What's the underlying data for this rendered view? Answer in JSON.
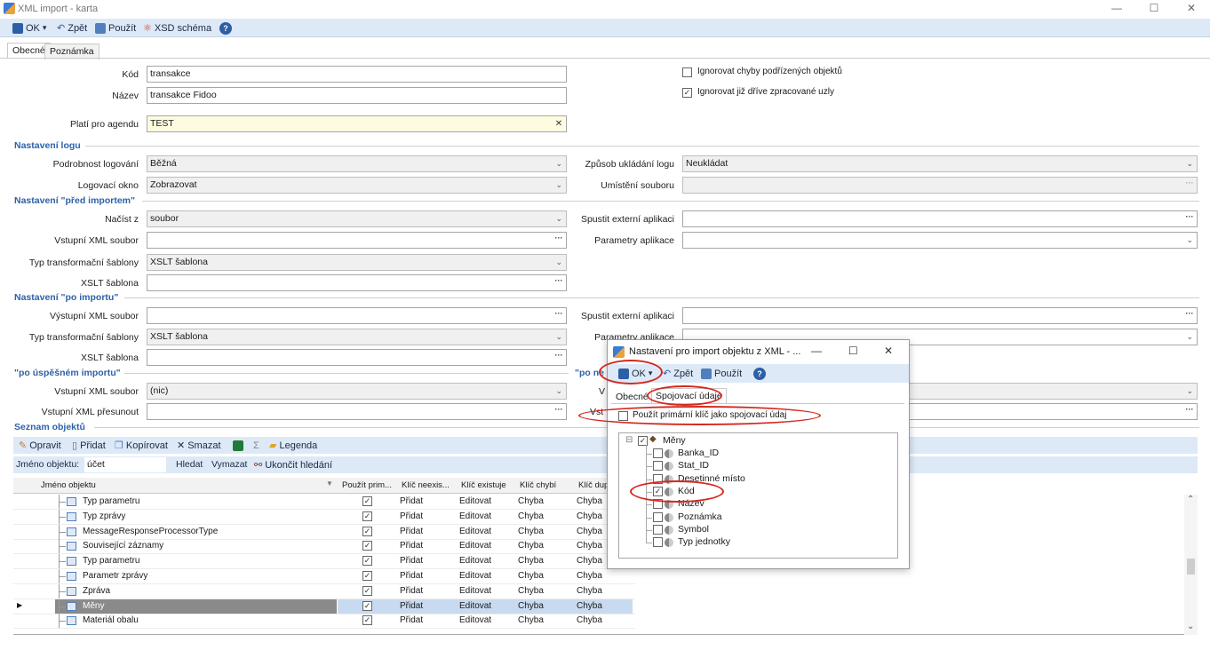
{
  "window": {
    "title": "XML import - karta",
    "min": "—",
    "max": "☐",
    "close": "✕"
  },
  "toolbar": {
    "ok": "OK",
    "dropdown": "▾",
    "back": "Zpět",
    "apply": "Použít",
    "xsd": "XSD schéma",
    "help": "?"
  },
  "tabs": [
    "Obecné",
    "Poznámka"
  ],
  "form": {
    "kod_label": "Kód",
    "kod": "transakce",
    "nazev_label": "Název",
    "nazev": "transakce Fidoo",
    "agenda_label": "Platí pro agendu",
    "agenda": "TEST",
    "clear": "✕",
    "ignore1_label": "Ignorovat chyby podřízených objektů",
    "ignore1": false,
    "ignore2_label": "Ignorovat již dříve zpracované uzly",
    "ignore2": true
  },
  "log": {
    "section": "Nastavení logu",
    "detail_label": "Podrobnost logování",
    "detail": "Běžná",
    "window_label": "Logovací okno",
    "window": "Zobrazovat",
    "save_label": "Způsob ukládání logu",
    "save": "Neukládat",
    "file_label": "Umístění souboru",
    "file": ""
  },
  "before": {
    "section": "Nastavení \"před importem\"",
    "load_label": "Načíst z",
    "load": "soubor",
    "in_label": "Vstupní XML soubor",
    "in": "",
    "type_label": "Typ transformační šablony",
    "type": "XSLT šablona",
    "xslt_label": "XSLT šablona",
    "xslt": "",
    "ext_label": "Spustit externí aplikaci",
    "ext": "",
    "params_label": "Parametry aplikace",
    "params": ""
  },
  "after": {
    "section": "Nastavení \"po importu\"",
    "out_label": "Výstupní XML soubor",
    "out": "",
    "type_label": "Typ transformační šablony",
    "type": "XSLT šablona",
    "xslt_label": "XSLT šablona",
    "xslt": "",
    "ext_label": "Spustit externí aplikaci",
    "ext": "",
    "params_label": "Parametry aplikace",
    "params": ""
  },
  "success": {
    "section": "\"po úspěšném importu\"",
    "section2": "\"po ne",
    "in_label": "Vstupní XML soubor",
    "in": "(nic)",
    "move_label": "Vstupní XML přesunout",
    "move": "",
    "clip1": "V",
    "clip2": "Vst"
  },
  "objects": {
    "section": "Seznam objektů",
    "edit": "Opravit",
    "add": "Přidat",
    "copy": "Kopírovat",
    "delete": "Smazat",
    "sigma": "Σ",
    "legend": "Legenda",
    "search_label": "Jméno objektu:",
    "search_value": "účet",
    "find": "Hledat",
    "clear": "Vymazat",
    "end": "Ukončit hledání",
    "columns": [
      "Jméno objektu",
      "Použít prim...",
      "Klíč neexis...",
      "Klíč existuje",
      "Klíč chybí",
      "Klíč dup"
    ],
    "rows": [
      {
        "name": "Typ parametru",
        "a": "Přidat",
        "b": "Editovat",
        "c": "Chyba",
        "d": "Chyba"
      },
      {
        "name": "Typ zprávy",
        "a": "Přidat",
        "b": "Editovat",
        "c": "Chyba",
        "d": "Chyba"
      },
      {
        "name": "MessageResponseProcessorType",
        "a": "Přidat",
        "b": "Editovat",
        "c": "Chyba",
        "d": "Chyba"
      },
      {
        "name": "Související záznamy",
        "a": "Přidat",
        "b": "Editovat",
        "c": "Chyba",
        "d": "Chyba"
      },
      {
        "name": "Typ parametru",
        "a": "Přidat",
        "b": "Editovat",
        "c": "Chyba",
        "d": "Chyba"
      },
      {
        "name": "Parametr zprávy",
        "a": "Přidat",
        "b": "Editovat",
        "c": "Chyba",
        "d": "Chyba"
      },
      {
        "name": "Zpráva",
        "a": "Přidat",
        "b": "Editovat",
        "c": "Chyba",
        "d": "Chyba"
      },
      {
        "name": "Měny",
        "a": "Přidat",
        "b": "Editovat",
        "c": "Chyba",
        "d": "Chyba"
      },
      {
        "name": "Materiál obalu",
        "a": "Přidat",
        "b": "Editovat",
        "c": "Chyba",
        "d": "Chyba"
      }
    ]
  },
  "dialog": {
    "title": "Nastavení pro import objektu z XML - ...",
    "min": "—",
    "max": "☐",
    "close": "✕",
    "ok": "OK",
    "dropdown": "▾",
    "back": "Zpět",
    "apply": "Použít",
    "help": "?",
    "tabs": [
      "Obecné",
      "Spojovací údaje"
    ],
    "use_pk_label": "Použít primární klíč jako spojovací údaj",
    "tree_expander": "⊟",
    "tree_root": "Měny",
    "tree": [
      {
        "label": "Banka_ID",
        "checked": false
      },
      {
        "label": "Stat_ID",
        "checked": false
      },
      {
        "label": "Desetinné místo",
        "checked": false
      },
      {
        "label": "Kód",
        "checked": true
      },
      {
        "label": "Název",
        "checked": false
      },
      {
        "label": "Poznámka",
        "checked": false
      },
      {
        "label": "Symbol",
        "checked": false
      },
      {
        "label": "Typ jednotky",
        "checked": false
      }
    ]
  },
  "icons": {
    "check": "✓",
    "caret": "⌄",
    "ellipsis": "···",
    "row_pointer": "▶",
    "filter": "▼",
    "scroll_up": "⌃",
    "scroll_down": "⌄"
  },
  "colors": {
    "toolbar": "#dde9f6",
    "section": "#2c62a8",
    "selected_row": "#8a8a8a",
    "highlight_row": "#c8daf0",
    "annotation": "#d4281e"
  }
}
